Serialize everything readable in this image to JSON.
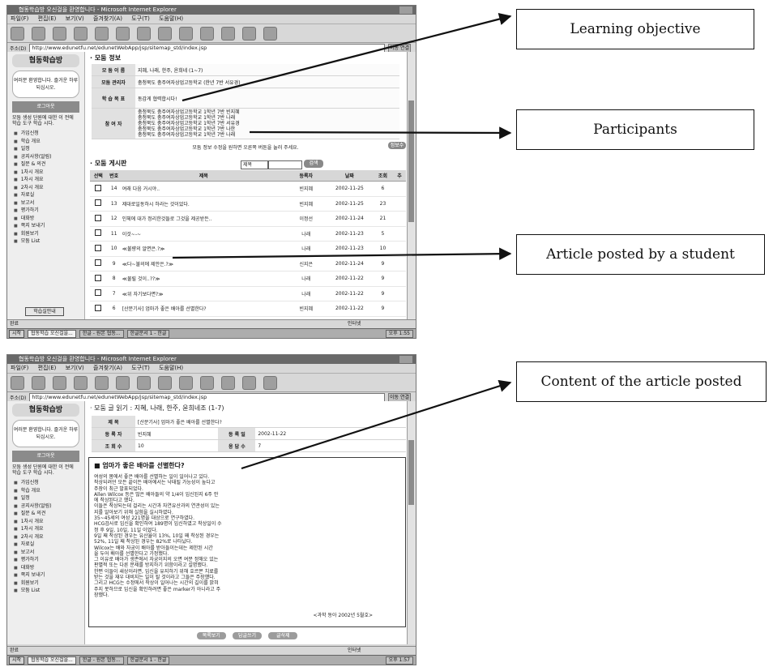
{
  "callouts": {
    "c1": "Learning objective",
    "c2": "Participants",
    "c3": "Article posted by a student",
    "c4": "Content of the article posted"
  },
  "browser1": {
    "title": "협동학습방 오신걸을 환영합니다 - Microsoft Internet Explorer",
    "menu": [
      "파일(F)",
      "편집(E)",
      "보기(V)",
      "즐겨찾기(A)",
      "도구(T)",
      "도움말(H)"
    ],
    "address_label": "주소(D)",
    "url": "http://www.edunetfu.net/edunetWebApp/jsp/sitemap_std/index.jsp",
    "go": "이동 연결",
    "status": "완료",
    "status_right": "인터넷",
    "taskbar": {
      "start": "시작",
      "items": [
        "협동학습 오신걸을...",
        "한글 - 원본 협동...",
        "한글문서 1 - 한글"
      ],
      "clock": "오후 1:55"
    }
  },
  "browser2": {
    "title": "협동학습방 오신걸을 환영합니다 - Microsoft Internet Explorer",
    "menu": [
      "파일(F)",
      "편집(E)",
      "보기(V)",
      "즐겨찾기(A)",
      "도구(T)",
      "도움말(H)"
    ],
    "address_label": "주소(D)",
    "url": "http://www.edunetfu.net/edunetWebApp/jsp/sitemap_std/index.jsp",
    "go": "이동 연결",
    "status": "완료",
    "status_right": "인터넷",
    "taskbar": {
      "start": "시작",
      "items": [
        "협동학습 오신걸을...",
        "한글 - 원본 협동...",
        "한글문서 1 - 한글"
      ],
      "clock": "오후 1:57"
    }
  },
  "sidebar": {
    "title": "협동학습방",
    "welcome": "여러분 환영합니다. 즐거운 하루 되십시오.",
    "banner": "로그아웃",
    "notice": "모둠 생성 단원에 대한 이 전에 학습 도구 학습 시다.",
    "menu": [
      "가입신청",
      "학습 개요",
      "일정",
      "공지사항(알림)",
      "질문 & 의견",
      "1차시 개요",
      "1차시 개요",
      "2차시 개요",
      "자료실",
      "보고서",
      "평가하기",
      "대화방",
      "쪽지 보내기",
      "회원보기",
      "모둠 List"
    ],
    "button": "학습실안내"
  },
  "group_info": {
    "section_title": "· 모둠 정보",
    "rows": {
      "name_label": "모 둠 이 름",
      "name_value": "지혜, 나래, 한주, 윤희네 (1~7)",
      "admin_label": "모둠 관리자",
      "admin_value": "충청북도 충주여자상업고등학교 (한년 7반 서유경)",
      "goal_label": "학 습 목 표",
      "goal_value": "동감게 협력합시다!",
      "members_label": "참 여 자",
      "members": [
        "충청북도 충주여자상업고등학교 1학년 7반 빈지혜",
        "충청북도 충주여자상업고등학교 1학년 7반 나래",
        "충청북도 충주여자상업고등학교 1학년 7반 서유경",
        "충청북도 충주여자상업고등학교 1학년 7반 나한",
        "충청북도 충주여자상업고등학교 1학년 7반 나래"
      ]
    },
    "edit_note": "모둠 정보 수정을 원하면 오른쪽 버튼을 눌러 주세요.",
    "edit_button": "정보수정"
  },
  "board": {
    "section_title": "· 모둠 게시판",
    "search_option": "제목",
    "search_button": "검색",
    "headers": [
      "선택",
      "번호",
      "제목",
      "등록자",
      "날짜",
      "조회",
      "추"
    ],
    "rows": [
      {
        "no": "14",
        "title": "여래 다음 거시야..",
        "author": "빈지혜",
        "date": "2002-11-25",
        "views": "6"
      },
      {
        "no": "13",
        "title": "제대로일동하시 하라는 것이었다.",
        "author": "빈지혜",
        "date": "2002-11-25",
        "views": "23"
      },
      {
        "no": "12",
        "title": "인체에 대가 정리한것들로 그것을 제공받든..",
        "author": "이정선",
        "date": "2002-11-24",
        "views": "21"
      },
      {
        "no": "11",
        "title": "이것~-~",
        "author": "나래",
        "date": "2002-11-23",
        "views": "5"
      },
      {
        "no": "10",
        "title": "≪불량의 알면은.?≫",
        "author": "나래",
        "date": "2002-11-23",
        "views": "10"
      },
      {
        "no": "9",
        "title": "≪다~불의에 제안은.?≫",
        "author": "신지은",
        "date": "2002-11-24",
        "views": "9"
      },
      {
        "no": "8",
        "title": "≪물릴 것이..??≫",
        "author": "나래",
        "date": "2002-11-22",
        "views": "9"
      },
      {
        "no": "7",
        "title": "≪위 자기보다면?≫",
        "author": "나래",
        "date": "2002-11-22",
        "views": "9"
      },
      {
        "no": "6",
        "title": "[산문기사] 엄마가 좋은 배아를 선별한다?",
        "author": "빈지혜",
        "date": "2002-11-22",
        "views": "9"
      },
      {
        "no": "5",
        "title": "[산문기사] 저런건 이기문?",
        "author": "빈지혜",
        "date": "2002-11-22",
        "views": "6"
      }
    ]
  },
  "read": {
    "section_title": "· 모둠 글 읽기 : 지혜, 나래, 한주, 윤희네조 (1-7)",
    "subject_label": "제 목",
    "subject_value": "[산문기사] 엄마가 좋은 배아를 선별한다?",
    "author_label": "등 록 자",
    "author_value": "빈지혜",
    "date_label": "등 록 일",
    "date_value": "2002-11-22",
    "views_label": "조 회 수",
    "views_value": "10",
    "reply_label": "응 답 수",
    "reply_value": "7",
    "article_title": "엄마가 좋은 배아를 선별한다?",
    "article_lines": [
      "여성의 몸에서 좋은 배아를 선별하는 일이 일어나고 있다.",
      "착상되려던 모든 끝이든 배아에서는 낙태될 가능성이 높다고",
      "주장이 최근 발표되었다.",
      "Allen Wilcox 등은 많은 배아들의 약 1/4이 임신된지 6주 안",
      "에 착상된다고 했다.",
      "이들은 착상되는데 걸리는 시간과 자연유산과의 연관성이 있는",
      "지를 알아보기 위해 실험을 실시하였다.",
      "35~45세의 여성 221명을 대상으로 연구하였다.",
      "HCG검사로 임신을 확인하여 189명이 임신하였고 착상일이 수",
      "정 후 9일, 10일, 11일 이었다.",
      "9일 째 착상된 경우는 유산율이 13%, 10일 째 착상된 경우는",
      "52%, 11일 째 착상된 경우는 82%로 나타났다.",
      "Wilcox는 배와 자궁이 배아를 받아들이는데는 제한된 시간",
      "을 두어 배아를 선별한다고 가정했다.",
      "그 이유로 배아가 생존에서 자궁이지의 오면 여분 정해오 있는",
      "판별적 또는 다른 문제를 방지하기 위함이라고 설명했다.",
      "한편 이들이 새상이라면, 임신을 유지하기 위해 호르몬 치료를",
      "받는 것을 재우 대비지는 일이 될 것이라고 그들은 주장했다.",
      "그리고 HCG는 수정에서 착상이 일어나는 시간의 길이를 밝혀",
      "주지 못하므로 임신을 확인하려면 좋은 marker가 아니라고 주",
      "장했다."
    ],
    "article_source": "<과학 동아 2002년 5월호>",
    "buttons": [
      "목록보기",
      "답글쓰기",
      "글삭제"
    ]
  }
}
